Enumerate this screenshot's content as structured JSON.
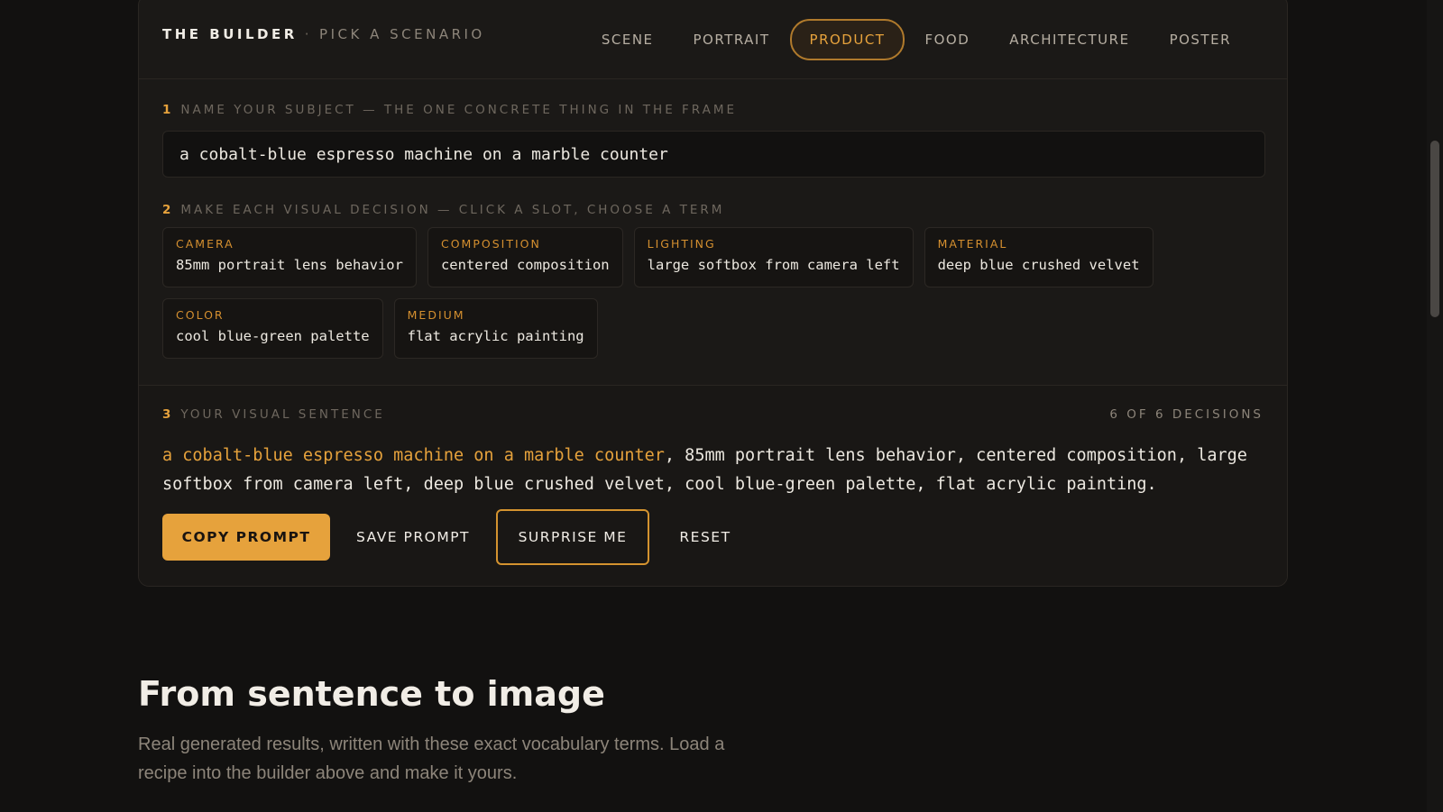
{
  "builder": {
    "brand": "THE BUILDER",
    "separator": "·",
    "subtitle": "PICK A SCENARIO",
    "tabs": [
      {
        "label": "SCENE"
      },
      {
        "label": "PORTRAIT"
      },
      {
        "label": "PRODUCT"
      },
      {
        "label": "FOOD"
      },
      {
        "label": "ARCHITECTURE"
      },
      {
        "label": "POSTER"
      }
    ],
    "active_tab": "PRODUCT",
    "step1": {
      "num": "1",
      "label": "NAME YOUR SUBJECT — THE ONE CONCRETE THING IN THE FRAME"
    },
    "subject_value": "a cobalt-blue espresso machine on a marble counter",
    "step2": {
      "num": "2",
      "label": "MAKE EACH VISUAL DECISION — CLICK A SLOT, CHOOSE A TERM"
    },
    "slots": [
      {
        "category": "CAMERA",
        "value": "85mm portrait lens behavior"
      },
      {
        "category": "COMPOSITION",
        "value": "centered composition"
      },
      {
        "category": "LIGHTING",
        "value": "large softbox from camera left"
      },
      {
        "category": "MATERIAL",
        "value": "deep blue crushed velvet"
      },
      {
        "category": "COLOR",
        "value": "cool blue-green palette"
      },
      {
        "category": "MEDIUM",
        "value": "flat acrylic painting"
      }
    ],
    "step3": {
      "num": "3",
      "label": "YOUR VISUAL SENTENCE"
    },
    "decisions_count": "6 OF 6 DECISIONS",
    "sentence": {
      "subject": "a cobalt-blue espresso machine on a marble counter",
      "rest": ", 85mm portrait lens behavior, centered composition, large softbox from camera left, deep blue crushed velvet, cool blue-green palette, flat acrylic painting."
    },
    "buttons": {
      "copy": "COPY PROMPT",
      "save": "SAVE PROMPT",
      "surprise": "SURPRISE ME",
      "reset": "RESET"
    }
  },
  "section": {
    "title": "From sentence to image",
    "description": "Real generated results, written with these exact vocabulary terms. Load a recipe into the builder above and make it yours."
  },
  "colors": {
    "accent": "#e6a23c",
    "background": "#121110",
    "panel": "#1b1917"
  }
}
